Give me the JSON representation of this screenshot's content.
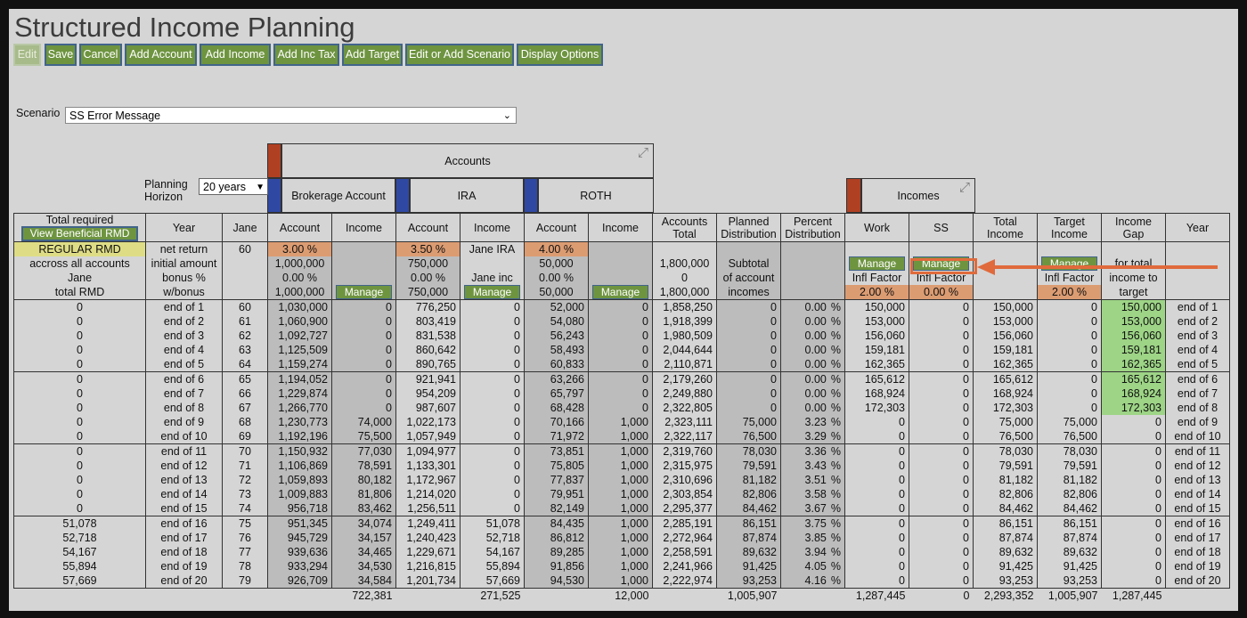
{
  "title": "Structured Income Planning",
  "toolbar": {
    "edit": "Edit",
    "save": "Save",
    "cancel": "Cancel",
    "add_account": "Add Account",
    "add_income": "Add Income",
    "add_inc_tax": "Add Inc Tax",
    "add_target": "Add Target",
    "edit_scenario": "Edit or Add Scenario",
    "display_options": "Display Options"
  },
  "scenario": {
    "label": "Scenario",
    "value": "SS Error Message"
  },
  "planning_horizon": {
    "label_line1": "Planning",
    "label_line2": "Horizon",
    "value": "20 years"
  },
  "groups": {
    "accounts": "Accounts",
    "incomes": "Incomes"
  },
  "accounts": {
    "brokerage": "Brokerage Account",
    "ira": "IRA",
    "roth": "ROTH"
  },
  "headers": {
    "total_required": "Total required",
    "view_rmd": "View Beneficial RMD",
    "year": "Year",
    "jane": "Jane",
    "account": "Account",
    "income": "Income",
    "accounts_total": "Accounts Total",
    "planned_dist": "Planned Distribution",
    "percent_dist": "Percent Distribution",
    "work": "Work",
    "ss": "SS",
    "total_income": "Total Income",
    "target_income": "Target Income",
    "income_gap": "Income Gap",
    "year2": "Year"
  },
  "meta": {
    "regular_rmd": "REGULAR RMD",
    "across": "accross all accounts",
    "jane_lbl": "Jane",
    "total_rmd": "total RMD",
    "net_return": "net return",
    "initial_amount": "initial amount",
    "bonus": "bonus %",
    "wbonus": "w/bonus",
    "jane_age": "60",
    "brok_rate": "3.00",
    "brok_init": "1,000,000",
    "brok_bonus": "0.00",
    "brok_wbonus": "1,000,000",
    "ira_rate": "3.50",
    "ira_init": "750,000",
    "ira_bonus": "0.00",
    "ira_wbonus": "750,000",
    "ira_inc_l1": "Jane IRA",
    "ira_inc_l2": "Jane inc",
    "roth_rate": "4.00",
    "roth_init": "50,000",
    "roth_bonus": "0.00",
    "roth_wbonus": "50,000",
    "acct_total_init": "1,800,000",
    "acct_total_bonus": "0",
    "acct_total_wbonus": "1,800,000",
    "planned_l1": "Subtotal",
    "planned_l2": "of account",
    "planned_l3": "incomes",
    "manage": "Manage",
    "infl_factor": "Infl Factor",
    "work_infl": "2.00",
    "ss_infl": "0.00",
    "target_infl": "2.00",
    "gap_l1": "for total",
    "gap_l2": "income to",
    "gap_l3": "target",
    "pct": "%"
  },
  "rows": [
    [
      "0",
      "end of 1",
      "60",
      "1,030,000",
      "0",
      "776,250",
      "0",
      "52,000",
      "0",
      "1,858,250",
      "0",
      "0.00",
      "150,000",
      "0",
      "150,000",
      "0",
      "150,000",
      "end of 1"
    ],
    [
      "0",
      "end of 2",
      "61",
      "1,060,900",
      "0",
      "803,419",
      "0",
      "54,080",
      "0",
      "1,918,399",
      "0",
      "0.00",
      "153,000",
      "0",
      "153,000",
      "0",
      "153,000",
      "end of 2"
    ],
    [
      "0",
      "end of 3",
      "62",
      "1,092,727",
      "0",
      "831,538",
      "0",
      "56,243",
      "0",
      "1,980,509",
      "0",
      "0.00",
      "156,060",
      "0",
      "156,060",
      "0",
      "156,060",
      "end of 3"
    ],
    [
      "0",
      "end of 4",
      "63",
      "1,125,509",
      "0",
      "860,642",
      "0",
      "58,493",
      "0",
      "2,044,644",
      "0",
      "0.00",
      "159,181",
      "0",
      "159,181",
      "0",
      "159,181",
      "end of 4"
    ],
    [
      "0",
      "end of 5",
      "64",
      "1,159,274",
      "0",
      "890,765",
      "0",
      "60,833",
      "0",
      "2,110,871",
      "0",
      "0.00",
      "162,365",
      "0",
      "162,365",
      "0",
      "162,365",
      "end of 5"
    ],
    [
      "0",
      "end of 6",
      "65",
      "1,194,052",
      "0",
      "921,941",
      "0",
      "63,266",
      "0",
      "2,179,260",
      "0",
      "0.00",
      "165,612",
      "0",
      "165,612",
      "0",
      "165,612",
      "end of 6"
    ],
    [
      "0",
      "end of 7",
      "66",
      "1,229,874",
      "0",
      "954,209",
      "0",
      "65,797",
      "0",
      "2,249,880",
      "0",
      "0.00",
      "168,924",
      "0",
      "168,924",
      "0",
      "168,924",
      "end of 7"
    ],
    [
      "0",
      "end of 8",
      "67",
      "1,266,770",
      "0",
      "987,607",
      "0",
      "68,428",
      "0",
      "2,322,805",
      "0",
      "0.00",
      "172,303",
      "0",
      "172,303",
      "0",
      "172,303",
      "end of 8"
    ],
    [
      "0",
      "end of 9",
      "68",
      "1,230,773",
      "74,000",
      "1,022,173",
      "0",
      "70,166",
      "1,000",
      "2,323,111",
      "75,000",
      "3.23",
      "0",
      "0",
      "75,000",
      "75,000",
      "0",
      "end of 9"
    ],
    [
      "0",
      "end of 10",
      "69",
      "1,192,196",
      "75,500",
      "1,057,949",
      "0",
      "71,972",
      "1,000",
      "2,322,117",
      "76,500",
      "3.29",
      "0",
      "0",
      "76,500",
      "76,500",
      "0",
      "end of 10"
    ],
    [
      "0",
      "end of 11",
      "70",
      "1,150,932",
      "77,030",
      "1,094,977",
      "0",
      "73,851",
      "1,000",
      "2,319,760",
      "78,030",
      "3.36",
      "0",
      "0",
      "78,030",
      "78,030",
      "0",
      "end of 11"
    ],
    [
      "0",
      "end of 12",
      "71",
      "1,106,869",
      "78,591",
      "1,133,301",
      "0",
      "75,805",
      "1,000",
      "2,315,975",
      "79,591",
      "3.43",
      "0",
      "0",
      "79,591",
      "79,591",
      "0",
      "end of 12"
    ],
    [
      "0",
      "end of 13",
      "72",
      "1,059,893",
      "80,182",
      "1,172,967",
      "0",
      "77,837",
      "1,000",
      "2,310,696",
      "81,182",
      "3.51",
      "0",
      "0",
      "81,182",
      "81,182",
      "0",
      "end of 13"
    ],
    [
      "0",
      "end of 14",
      "73",
      "1,009,883",
      "81,806",
      "1,214,020",
      "0",
      "79,951",
      "1,000",
      "2,303,854",
      "82,806",
      "3.58",
      "0",
      "0",
      "82,806",
      "82,806",
      "0",
      "end of 14"
    ],
    [
      "0",
      "end of 15",
      "74",
      "956,718",
      "83,462",
      "1,256,511",
      "0",
      "82,149",
      "1,000",
      "2,295,377",
      "84,462",
      "3.67",
      "0",
      "0",
      "84,462",
      "84,462",
      "0",
      "end of 15"
    ],
    [
      "51,078",
      "end of 16",
      "75",
      "951,345",
      "34,074",
      "1,249,411",
      "51,078",
      "84,435",
      "1,000",
      "2,285,191",
      "86,151",
      "3.75",
      "0",
      "0",
      "86,151",
      "86,151",
      "0",
      "end of 16"
    ],
    [
      "52,718",
      "end of 17",
      "76",
      "945,729",
      "34,157",
      "1,240,423",
      "52,718",
      "86,812",
      "1,000",
      "2,272,964",
      "87,874",
      "3.85",
      "0",
      "0",
      "87,874",
      "87,874",
      "0",
      "end of 17"
    ],
    [
      "54,167",
      "end of 18",
      "77",
      "939,636",
      "34,465",
      "1,229,671",
      "54,167",
      "89,285",
      "1,000",
      "2,258,591",
      "89,632",
      "3.94",
      "0",
      "0",
      "89,632",
      "89,632",
      "0",
      "end of 18"
    ],
    [
      "55,894",
      "end of 19",
      "78",
      "933,294",
      "34,530",
      "1,216,815",
      "55,894",
      "91,856",
      "1,000",
      "2,241,966",
      "91,425",
      "4.05",
      "0",
      "0",
      "91,425",
      "91,425",
      "0",
      "end of 19"
    ],
    [
      "57,669",
      "end of 20",
      "79",
      "926,709",
      "34,584",
      "1,201,734",
      "57,669",
      "94,530",
      "1,000",
      "2,222,974",
      "93,253",
      "4.16",
      "0",
      "0",
      "93,253",
      "93,253",
      "0",
      "end of 20"
    ]
  ],
  "totals": {
    "brok_income": "722,381",
    "ira_income": "271,525",
    "roth_income": "12,000",
    "planned": "1,005,907",
    "work": "1,287,445",
    "ss": "0",
    "total_income": "2,293,352",
    "target": "1,005,907",
    "gap": "1,287,445"
  },
  "colors": {
    "button_green": "#6e9440",
    "header_red": "#b04022",
    "header_blue": "#2f49a3",
    "orange_cell": "#dc9c72",
    "green_cell": "#9dd486",
    "annotation": "#e06a3c"
  }
}
